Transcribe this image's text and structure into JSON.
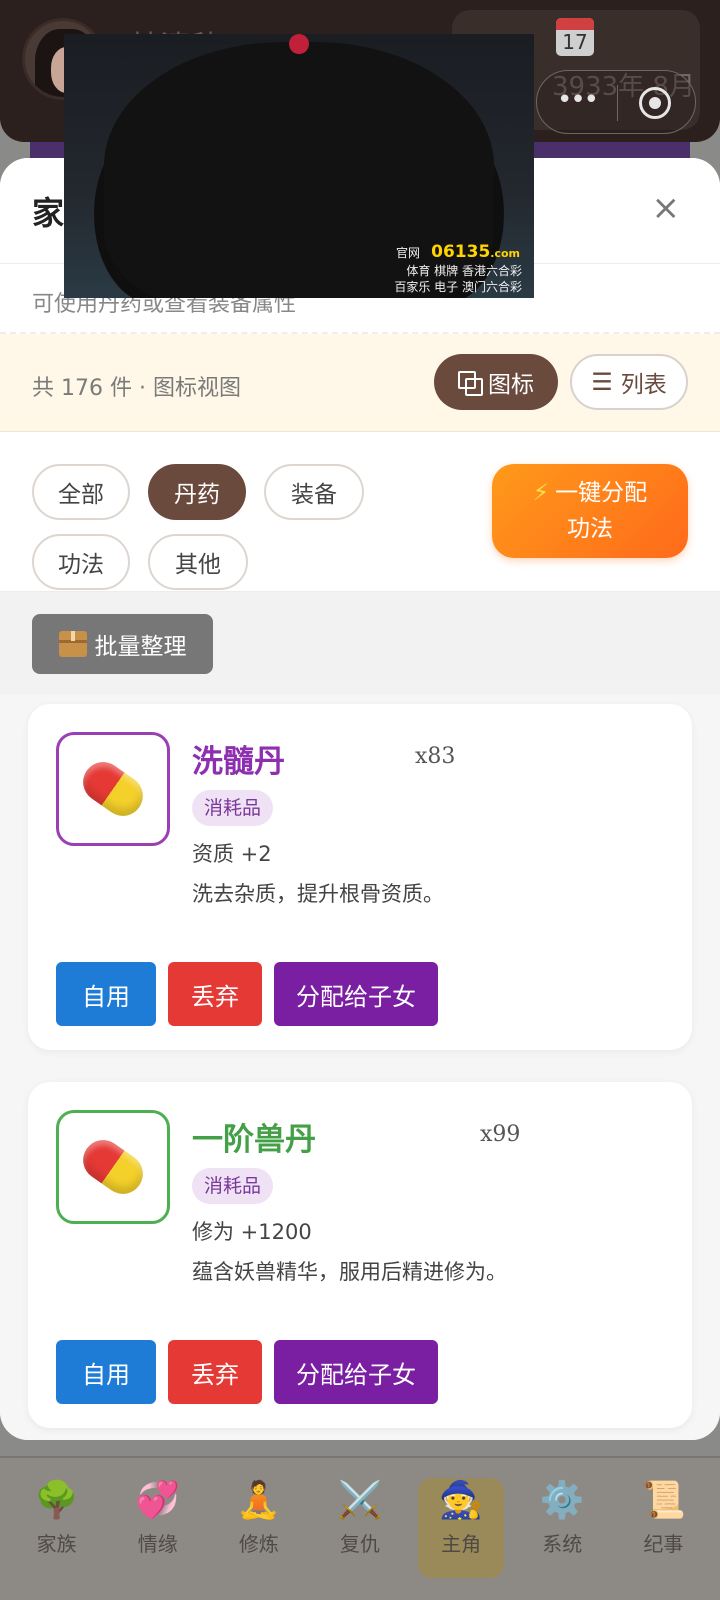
{
  "background": {
    "user_name": "韩清秋",
    "calendar_icon_day": "17",
    "date": "3933年 8月",
    "capsule": {
      "more_icon": "more-dots-icon",
      "close_icon": "target-icon"
    }
  },
  "modal": {
    "title": "家",
    "hint": "可使用丹药或查看装备属性",
    "close_label": "×",
    "count_text": "共 176 件 · 图标视图",
    "view_grid_label": "图标",
    "view_list_label": "列表",
    "filters": [
      "全部",
      "丹药",
      "装备",
      "功法",
      "其他"
    ],
    "active_filter": "丹药",
    "auto_assign_label_1": "一键分配",
    "auto_assign_label_2": "功法",
    "batch_label": "批量整理"
  },
  "items": [
    {
      "name": "洗髓丹",
      "qty": "x83",
      "tag": "消耗品",
      "effect": "资质 +2",
      "desc": "洗去杂质，提升根骨资质。",
      "name_color": "#8e2fb0",
      "border_color": "#9b3fb5",
      "actions": {
        "use": "自用",
        "drop": "丢弃",
        "assign": "分配给子女"
      }
    },
    {
      "name": "一阶兽丹",
      "qty": "x99",
      "tag": "消耗品",
      "effect": "修为 +1200",
      "desc": "蕴含妖兽精华，服用后精进修为。",
      "name_color": "#43a047",
      "border_color": "#4caf50",
      "actions": {
        "use": "自用",
        "drop": "丢弃",
        "assign": "分配给子女"
      }
    }
  ],
  "bottom_nav": [
    {
      "label": "家族",
      "icon": "🌳",
      "icon_name": "tree-icon"
    },
    {
      "label": "情缘",
      "icon": "💞",
      "icon_name": "hearts-icon"
    },
    {
      "label": "修炼",
      "icon": "🧘",
      "icon_name": "meditate-icon"
    },
    {
      "label": "复仇",
      "icon": "⚔️",
      "icon_name": "swords-icon"
    },
    {
      "label": "主角",
      "icon": "🧙",
      "icon_name": "mage-icon",
      "active": true
    },
    {
      "label": "系统",
      "icon": "⚙️",
      "icon_name": "gear-icon"
    },
    {
      "label": "纪事",
      "icon": "📜",
      "icon_name": "scroll-icon"
    }
  ],
  "video_ad": {
    "brand": "06135",
    "brand_suffix": ".com",
    "line1": "官网",
    "line2": "体育 棋牌 香港六合彩",
    "line3": "百家乐 电子 澳门六合彩"
  },
  "colors": {
    "primary_brown": "#6b4a3e",
    "accent_orange": "#ff7a1a",
    "use_blue": "#1e7bd6",
    "drop_red": "#e53935",
    "assign_purple": "#7b1fa2"
  }
}
